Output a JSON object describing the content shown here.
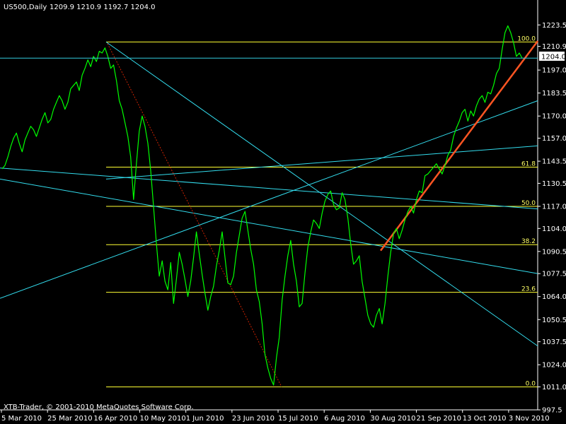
{
  "header": {
    "symbol": "US500,Daily",
    "ohlc": "1209.9 1210.9 1192.7 1204.0"
  },
  "copyright": "XTB-Trader, © 2001-2010 MetaQuotes Software Corp.",
  "current_price_label": "1204.0",
  "colors": {
    "background": "#000000",
    "price_line": "#00ff00",
    "trend_lines": "#33ddee",
    "fib_lines": "#ffff33",
    "uptrend": "#ff5522",
    "down_dotted": "#cc2200",
    "axis": "#ffffff"
  },
  "chart_data": {
    "type": "line",
    "title": "",
    "x_axis": {
      "ticks": [
        "5 Mar 2010",
        "25 Mar 2010",
        "16 Apr 2010",
        "10 May 2010",
        "1 Jun 2010",
        "23 Jun 2010",
        "15 Jul 2010",
        "6 Aug 2010",
        "30 Aug 2010",
        "21 Sep 2010",
        "13 Oct 2010",
        "3 Nov 2010"
      ]
    },
    "y_axis": {
      "ylim": [
        997.5,
        1229.0
      ],
      "ticks": [
        "1223.5",
        "1210.9",
        "1197.0",
        "1183.5",
        "1170.0",
        "1157.0",
        "1143.5",
        "1130.5",
        "1117.0",
        "1104.0",
        "1090.5",
        "1077.5",
        "1064.0",
        "1050.5",
        "1037.5",
        "1024.0",
        "1011.0",
        "997.5"
      ],
      "position": "right"
    },
    "current_price": 1204.0,
    "series": [
      {
        "type": "line",
        "values": [
          1139,
          1141,
          1146,
          1152,
          1157,
          1160,
          1154,
          1149,
          1156,
          1160,
          1164,
          1162,
          1158,
          1163,
          1168,
          1172,
          1166,
          1168,
          1174,
          1178,
          1182,
          1179,
          1174,
          1178,
          1186,
          1188,
          1190,
          1185,
          1194,
          1198,
          1203,
          1199,
          1205,
          1202,
          1208,
          1207,
          1210,
          1205,
          1198,
          1200,
          1191,
          1179,
          1174,
          1166,
          1158,
          1146,
          1121,
          1142,
          1161,
          1170,
          1164,
          1154,
          1138,
          1117,
          1095,
          1076,
          1085,
          1073,
          1068,
          1084,
          1060,
          1074,
          1090,
          1083,
          1074,
          1064,
          1073,
          1087,
          1102,
          1089,
          1077,
          1066,
          1056,
          1064,
          1070,
          1082,
          1091,
          1102,
          1087,
          1072,
          1071,
          1076,
          1090,
          1100,
          1110,
          1114,
          1103,
          1092,
          1083,
          1068,
          1061,
          1048,
          1030,
          1022,
          1016,
          1012,
          1028,
          1040,
          1062,
          1076,
          1088,
          1097,
          1083,
          1073,
          1058,
          1060,
          1078,
          1093,
          1102,
          1109,
          1107,
          1104,
          1113,
          1120,
          1124,
          1126,
          1118,
          1115,
          1116,
          1125,
          1121,
          1110,
          1095,
          1083,
          1085,
          1088,
          1073,
          1063,
          1053,
          1048,
          1046,
          1053,
          1057,
          1048,
          1060,
          1076,
          1090,
          1101,
          1104,
          1098,
          1103,
          1109,
          1114,
          1117,
          1113,
          1121,
          1126,
          1125,
          1135,
          1136,
          1138,
          1140,
          1142,
          1139,
          1136,
          1141,
          1147,
          1150,
          1158,
          1163,
          1167,
          1172,
          1174,
          1167,
          1173,
          1170,
          1176,
          1180,
          1182,
          1178,
          1184,
          1183,
          1188,
          1195,
          1198,
          1209,
          1219,
          1223,
          1219,
          1213,
          1205,
          1207,
          1204
        ]
      }
    ],
    "fibonacci": [
      {
        "level": "100.0",
        "price": 1213.5
      },
      {
        "level": "61.8",
        "price": 1140.0
      },
      {
        "level": "50.0",
        "price": 1117.0
      },
      {
        "level": "38.2",
        "price": 1094.5
      },
      {
        "level": "23.6",
        "price": 1066.5
      },
      {
        "level": "0.0",
        "price": 1011.0
      }
    ]
  }
}
